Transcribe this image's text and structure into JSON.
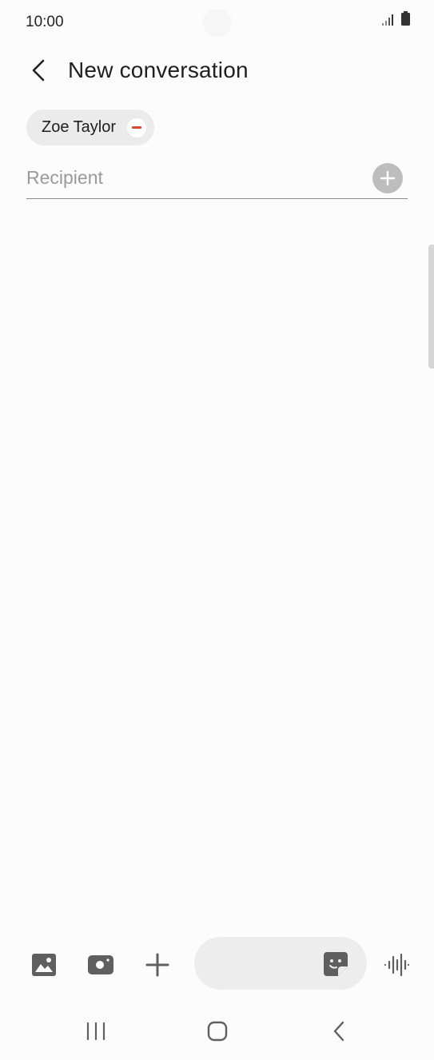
{
  "status_bar": {
    "time": "10:00",
    "signal_icon": "signal-bars-icon",
    "battery_icon": "battery-icon"
  },
  "header": {
    "back_icon": "chevron-left-icon",
    "title": "New conversation"
  },
  "recipients": {
    "chips": [
      {
        "name": "Zoe Taylor",
        "remove_icon": "minus-circle-icon"
      }
    ],
    "input": {
      "value": "",
      "placeholder": "Recipient"
    },
    "add_icon": "plus-circle-icon"
  },
  "compose": {
    "tools": [
      "gallery-icon",
      "camera-icon",
      "plus-icon"
    ],
    "message": {
      "value": "",
      "placeholder": ""
    },
    "sticker_icon": "sticker-icon",
    "voice_icon": "voice-waveform-icon"
  },
  "navigation": {
    "recents_icon": "recent-apps-icon",
    "home_icon": "home-icon",
    "back_icon": "back-icon"
  },
  "colors": {
    "background": "#fcfcfc",
    "chip_background": "#ebebeb",
    "remove_accent": "#e2442f",
    "add_button": "#bdbdbd",
    "icon_gray": "#5f5f5f"
  }
}
